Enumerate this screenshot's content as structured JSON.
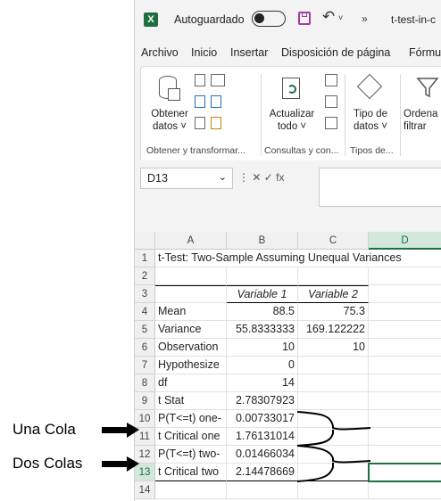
{
  "titlebar": {
    "logo": "X",
    "autosave_label": "Autoguardado",
    "more": "»",
    "doc_title": "t-test-in-c"
  },
  "ribbon_tabs": [
    "Archivo",
    "Inicio",
    "Insertar",
    "Disposición de página",
    "Fórmu"
  ],
  "ribbon": {
    "btn_obtener": "Obtener\ndatos ˅",
    "btn_actualizar": "Actualizar\ntodo ˅",
    "btn_tipo": "Tipo de\ndatos ˅",
    "btn_ordenar": "Ordena\nfiltrar",
    "group_obtener": "Obtener y transformar...",
    "group_consultas": "Consultas y con...",
    "group_tipos": "Tipos de..."
  },
  "formula_bar": {
    "name_box": "D13",
    "icons": "⋮  ✕  ✓  fx"
  },
  "columns": [
    "A",
    "B",
    "C",
    "D"
  ],
  "rows": [
    "1",
    "2",
    "3",
    "4",
    "5",
    "6",
    "7",
    "8",
    "9",
    "10",
    "11",
    "12",
    "13",
    "14"
  ],
  "sheet": {
    "title": "t-Test: Two-Sample Assuming Unequal Variances",
    "header_var1": "Variable 1",
    "header_var2": "Variable 2",
    "data": [
      {
        "label": "Mean",
        "v1": "88.5",
        "v2": "75.3"
      },
      {
        "label": "Variance",
        "v1": "55.8333333",
        "v2": "169.122222"
      },
      {
        "label": "Observation",
        "v1": "10",
        "v2": "10"
      },
      {
        "label": "Hypothesize",
        "v1": "0",
        "v2": ""
      },
      {
        "label": "df",
        "v1": "14",
        "v2": ""
      },
      {
        "label": "t Stat",
        "v1": "2.78307923",
        "v2": ""
      },
      {
        "label": "P(T<=t) one-",
        "v1": "0.00733017",
        "v2": ""
      },
      {
        "label": "t Critical one",
        "v1": "1.76131014",
        "v2": ""
      },
      {
        "label": "P(T<=t) two-",
        "v1": "0.01466034",
        "v2": ""
      },
      {
        "label": "t Critical two",
        "v1": "2.14478669",
        "v2": ""
      }
    ]
  },
  "annotations": {
    "una_cola": "Una Cola",
    "dos_colas": "Dos Colas"
  },
  "colors": {
    "excel_green": "#1d6f42",
    "save_purple": "#a43b9e"
  }
}
